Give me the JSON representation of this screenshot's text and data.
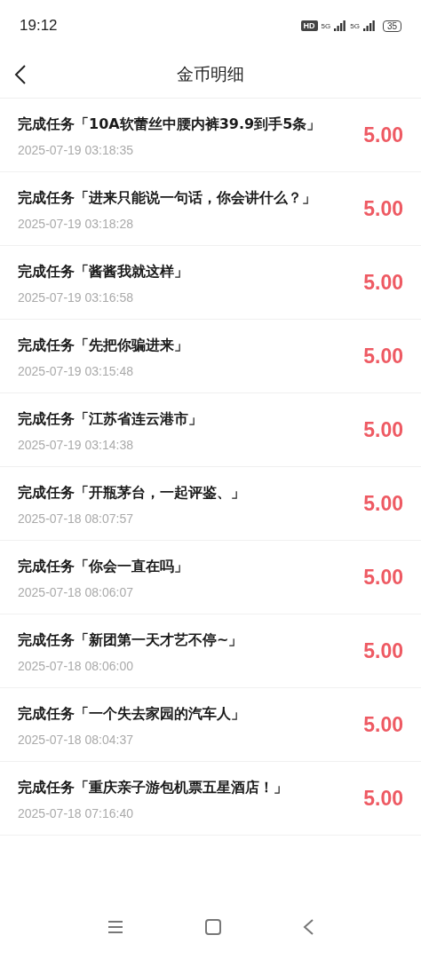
{
  "status_bar": {
    "time": "19:12",
    "hd_badge": "HD",
    "signals": [
      "5G",
      "5G"
    ],
    "battery": "35"
  },
  "header": {
    "title": "金币明细"
  },
  "records": [
    {
      "title": "完成任务「10A软蕾丝中腰内裤39.9到手5条」",
      "time": "2025-07-19 03:18:35",
      "amount": "5.00"
    },
    {
      "title": "完成任务「进来只能说一句话，你会讲什么？」",
      "time": "2025-07-19 03:18:28",
      "amount": "5.00"
    },
    {
      "title": "完成任务「酱酱我就这样」",
      "time": "2025-07-19 03:16:58",
      "amount": "5.00"
    },
    {
      "title": "完成任务「先把你骗进来」",
      "time": "2025-07-19 03:15:48",
      "amount": "5.00"
    },
    {
      "title": "完成任务「江苏省连云港市」",
      "time": "2025-07-19 03:14:38",
      "amount": "5.00"
    },
    {
      "title": "完成任务「开瓶茅台，一起评鉴、」",
      "time": "2025-07-18 08:07:57",
      "amount": "5.00"
    },
    {
      "title": "完成任务「你会一直在吗」",
      "time": "2025-07-18 08:06:07",
      "amount": "5.00"
    },
    {
      "title": "完成任务「新团第一天才艺不停~」",
      "time": "2025-07-18 08:06:00",
      "amount": "5.00"
    },
    {
      "title": "完成任务「一个失去家园的汽车人」",
      "time": "2025-07-18 08:04:37",
      "amount": "5.00"
    },
    {
      "title": "完成任务「重庆亲子游包机票五星酒店！」",
      "time": "2025-07-18 07:16:40",
      "amount": "5.00"
    }
  ]
}
